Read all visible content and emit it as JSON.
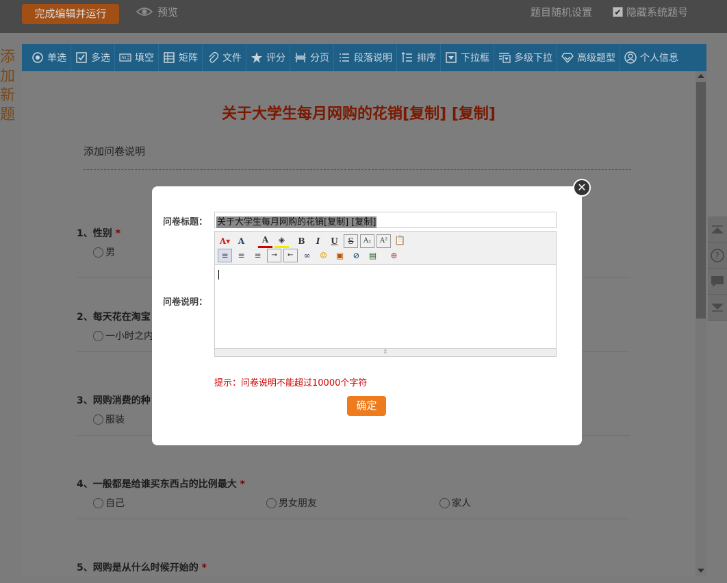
{
  "topbar": {
    "finish_label": "完成编辑并运行",
    "preview_label": "预览",
    "random_label": "题目随机设置",
    "hide_label": "隐藏系统题号"
  },
  "side_deco": [
    "添",
    "加",
    "新",
    "题"
  ],
  "toolbar": {
    "items": [
      {
        "label": "单选",
        "icon": "radio-icon"
      },
      {
        "label": "多选",
        "icon": "checkbox-icon"
      },
      {
        "label": "填空",
        "icon": "text-field-icon"
      },
      {
        "label": "矩阵",
        "icon": "matrix-icon"
      },
      {
        "label": "文件",
        "icon": "paperclip-icon"
      },
      {
        "label": "评分",
        "icon": "star-icon"
      },
      {
        "label": "分页",
        "icon": "page-break-icon"
      },
      {
        "label": "段落说明",
        "icon": "paragraph-icon"
      },
      {
        "label": "排序",
        "icon": "sort-icon"
      },
      {
        "label": "下拉框",
        "icon": "dropdown-icon"
      },
      {
        "label": "多级下拉",
        "icon": "multi-dropdown-icon"
      },
      {
        "label": "高级题型",
        "icon": "diamond-icon"
      },
      {
        "label": "个人信息",
        "icon": "user-icon"
      }
    ]
  },
  "survey": {
    "title": "关于大学生每月网购的花销[复制] [复制]",
    "desc": "添加问卷说明",
    "questions": [
      {
        "title": "1、性别",
        "required": "*",
        "options": [
          "男"
        ]
      },
      {
        "title": "2、每天花在淘宝",
        "required": "",
        "options": [
          "一小时之内"
        ]
      },
      {
        "title": "3、网购消费的种",
        "required": "",
        "options": [
          "服装"
        ]
      },
      {
        "title": "4、一般都是给谁买东西占的比例最大",
        "required": "*",
        "options": [
          "自己",
          "男女朋友",
          "家人"
        ]
      },
      {
        "title": "5、网购是从什么时候开始的",
        "required": "*",
        "options": []
      }
    ]
  },
  "modal": {
    "title_label": "问卷标题：",
    "title_value": "关于大学生每月网购的花销[复制] [复制]",
    "desc_label": "问卷说明：",
    "hint": "提示：问卷说明不能超过10000个字符",
    "ok_label": "确定",
    "close_glyph": "✕"
  }
}
